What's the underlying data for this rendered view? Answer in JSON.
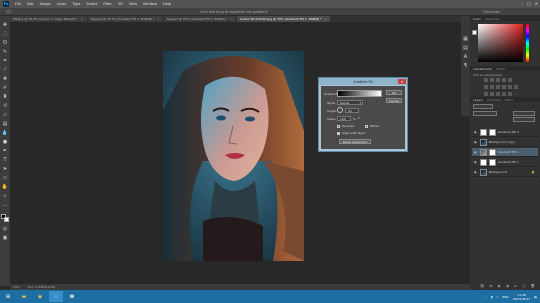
{
  "menubar": {
    "logo": "Ps",
    "items": [
      "File",
      "Edit",
      "Image",
      "Layer",
      "Type",
      "Select",
      "Filter",
      "3D",
      "View",
      "Window",
      "Help"
    ]
  },
  "optionsbar": {
    "message": "Click and drag to reposition the gradient.",
    "workspace": "Essentials"
  },
  "tabs": [
    {
      "label": "Fitbgrg @ 33.3% (Colour 1, Layer Mask/8) *",
      "active": false
    },
    {
      "label": "Sky.psd @ 33.3% (Gradient Fill 1, RGB/8) *",
      "active": false
    },
    {
      "label": "Sky.psd @ 33% (Gradient Fill 1, RGB/8) *",
      "active": false
    },
    {
      "label": "Colour bit Portrait.jpg @ 33% (Gradient Fill 1, RGB/8) *",
      "active": true
    }
  ],
  "statusbar": {
    "zoom": "33%",
    "doc": "Doc: 5.49M/12.0M"
  },
  "dialog": {
    "title": "Gradient Fill",
    "gradient_label": "Gradient:",
    "style_label": "Style:",
    "style_value": "Radial",
    "angle_label": "Angle:",
    "angle_value": "90",
    "scale_label": "Scale:",
    "scale_value": "100",
    "scale_unit": "%",
    "reverse_label": "Reverse",
    "dither_label": "Dither",
    "align_label": "Align with layer",
    "reset_label": "Reset Alignment",
    "ok_label": "OK",
    "cancel_label": "Cancel",
    "reverse_checked": false,
    "dither_checked": false,
    "align_checked": true
  },
  "panels": {
    "color_tab": "Color",
    "swatches_tab": "Swatches",
    "adjustments_tab": "Adjustments",
    "styles_tab": "Styles",
    "add_adjustment": "Add an adjustment",
    "layers_tab": "Layers",
    "channels_tab": "Channels",
    "paths_tab": "Paths"
  },
  "layers": [
    {
      "name": "Gradient Fill 2",
      "thumb": "white",
      "selected": false
    },
    {
      "name": "Background copy",
      "thumb": "dark",
      "selected": false
    },
    {
      "name": "Gradient Fill 1",
      "thumb": "photo",
      "selected": true
    },
    {
      "name": "Gradient Fill 1",
      "thumb": "white",
      "selected": false
    },
    {
      "name": "Background",
      "thumb": "dark",
      "selected": false
    }
  ],
  "taskbar": {
    "lang": "ENG",
    "time": "11:38",
    "date": "09/01/2017"
  },
  "colors": {
    "accent": "#1d6fa3",
    "dialog_frame": "#a9c4d6",
    "close_red": "#c9413a",
    "selected_layer": "#4b5e6e"
  }
}
